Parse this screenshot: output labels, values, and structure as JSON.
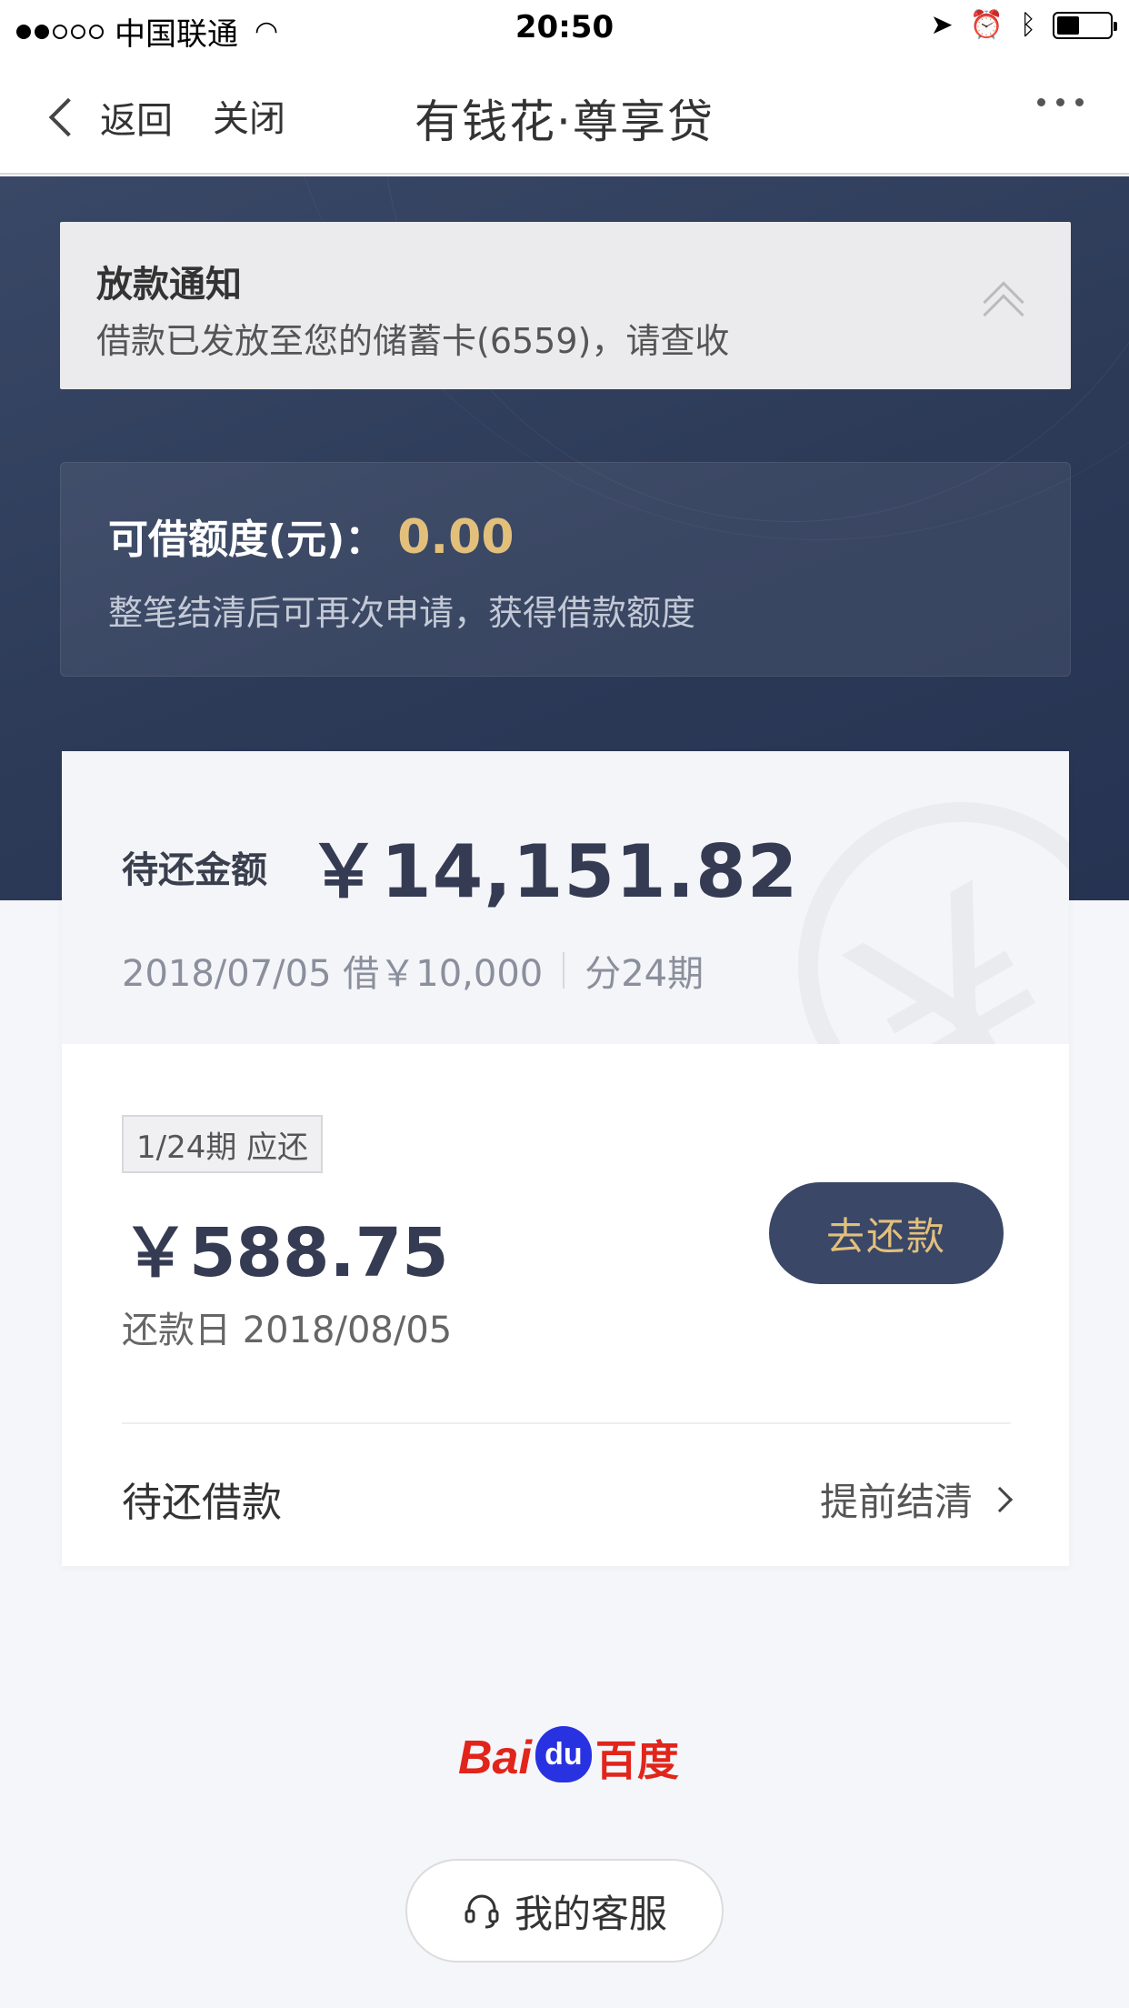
{
  "status_bar": {
    "carrier": "中国联通",
    "time": "20:50"
  },
  "nav": {
    "back_label": "返回",
    "close_label": "关闭",
    "title": "有钱花·尊享贷"
  },
  "notice": {
    "title": "放款通知",
    "text": "借款已发放至您的储蓄卡(6559)，请查收"
  },
  "quota": {
    "label": "可借额度(元)：",
    "value": "0.00",
    "hint": "整笔结清后可再次申请，获得借款额度"
  },
  "summary": {
    "due_label": "待还金额",
    "due_amount": "￥14,151.82",
    "loan_date_amount": "2018/07/05 借￥10,000",
    "installments": "分24期"
  },
  "current_period": {
    "badge": "1/24期 应还",
    "amount": "￥588.75",
    "due_date": "还款日 2018/08/05",
    "repay_button": "去还款"
  },
  "footer_row": {
    "pending_label": "待还借款",
    "payoff_link": "提前结清"
  },
  "brand": {
    "bai": "Bai",
    "du": "du",
    "chinese": "百度"
  },
  "customer_service": {
    "label": "我的客服"
  },
  "colors": {
    "header_bg": "#2c3a58",
    "accent_gold": "#e2c07c",
    "button_bg": "#3a4767",
    "baidu_red": "#e1251b",
    "baidu_blue": "#2932e1"
  }
}
